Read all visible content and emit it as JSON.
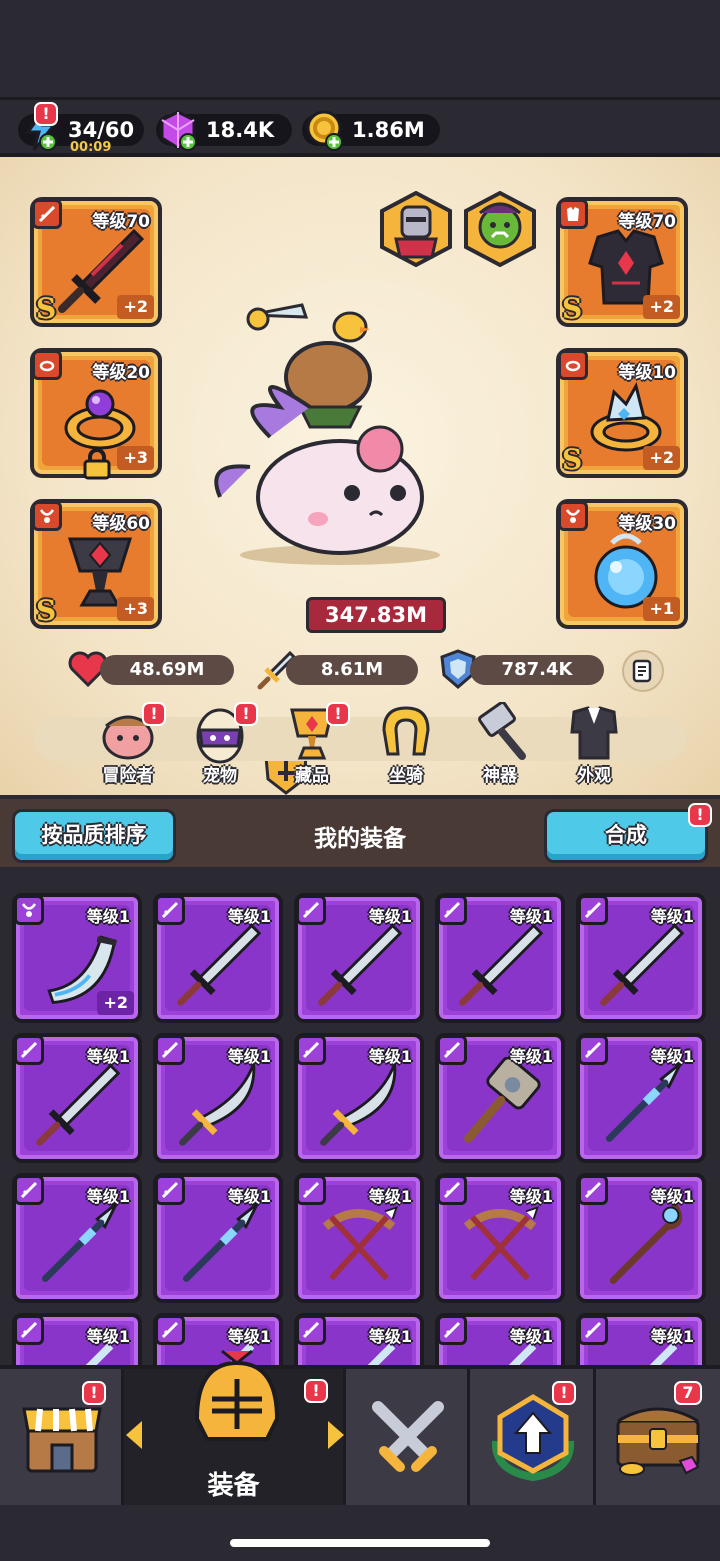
{
  "resources": {
    "energy": {
      "value": "34/60",
      "timer": "00:09",
      "icon": "lightning-icon"
    },
    "gems": {
      "value": "18.4K",
      "icon": "gem-icon"
    },
    "coins": {
      "value": "1.86M",
      "icon": "coin-icon"
    }
  },
  "left_equipment": [
    {
      "slot": "weapon",
      "level": "等级70",
      "grade": "S",
      "plus": "+2",
      "icon": "dark-sword-icon"
    },
    {
      "slot": "ring",
      "level": "等级20",
      "grade": "",
      "plus": "+3",
      "icon": "ring-icon",
      "locked": true
    },
    {
      "slot": "necklace",
      "level": "等级60",
      "grade": "S",
      "plus": "+3",
      "icon": "chalice-amulet-icon"
    }
  ],
  "right_equipment": [
    {
      "slot": "armor",
      "level": "等级70",
      "grade": "S",
      "plus": "+2",
      "icon": "dark-armor-icon"
    },
    {
      "slot": "ring",
      "level": "等级10",
      "grade": "S",
      "plus": "+2",
      "icon": "crystal-ring-icon"
    },
    {
      "slot": "necklace",
      "level": "等级30",
      "grade": "",
      "plus": "+1",
      "icon": "blue-orb-icon"
    }
  ],
  "portraits": [
    "knight-portrait-icon",
    "orc-portrait-icon"
  ],
  "power": "347.83M",
  "stats": {
    "hp": "48.69M",
    "attack": "8.61M",
    "defense": "787.4K"
  },
  "features": [
    {
      "label": "冒险者",
      "icon": "adventurer-icon",
      "alert": true
    },
    {
      "label": "宠物",
      "icon": "pet-egg-icon",
      "alert": true
    },
    {
      "label": "藏品",
      "icon": "collection-trophy-icon",
      "alert": true
    },
    {
      "label": "坐骑",
      "icon": "mount-horseshoe-icon",
      "alert": false
    },
    {
      "label": "神器",
      "icon": "artifact-hammer-icon",
      "alert": false
    },
    {
      "label": "外观",
      "icon": "outfit-icon",
      "alert": false
    }
  ],
  "inventory": {
    "sort_label": "按品质排序",
    "title": "我的装备",
    "merge_label": "合成",
    "merge_alert": "!",
    "item_level": "等级1",
    "rows": [
      [
        {
          "icon": "horn-icon",
          "type": "necklace",
          "plus": "+2"
        },
        {
          "icon": "iron-sword-icon",
          "type": "weapon"
        },
        {
          "icon": "iron-sword-icon",
          "type": "weapon"
        },
        {
          "icon": "iron-sword-icon",
          "type": "weapon"
        },
        {
          "icon": "iron-sword-icon",
          "type": "weapon"
        }
      ],
      [
        {
          "icon": "iron-sword-icon",
          "type": "weapon"
        },
        {
          "icon": "scimitar-icon",
          "type": "weapon"
        },
        {
          "icon": "scimitar-icon",
          "type": "weapon"
        },
        {
          "icon": "stone-hammer-icon",
          "type": "weapon"
        },
        {
          "icon": "spear-icon",
          "type": "weapon"
        }
      ],
      [
        {
          "icon": "spear-icon",
          "type": "weapon"
        },
        {
          "icon": "spear-icon",
          "type": "weapon"
        },
        {
          "icon": "crossbow-icon",
          "type": "weapon"
        },
        {
          "icon": "crossbow-icon",
          "type": "weapon"
        },
        {
          "icon": "staff-icon",
          "type": "weapon"
        }
      ],
      [
        {
          "icon": "weapon-icon",
          "type": "weapon"
        },
        {
          "icon": "weapon-icon",
          "type": "weapon"
        },
        {
          "icon": "weapon-icon",
          "type": "weapon"
        },
        {
          "icon": "weapon-icon",
          "type": "weapon"
        },
        {
          "icon": "weapon-icon",
          "type": "weapon"
        }
      ]
    ]
  },
  "bottom_nav": [
    {
      "id": "shop",
      "label": "",
      "icon": "shop-icon",
      "badge": "!"
    },
    {
      "id": "equipment",
      "label": "装备",
      "icon": "helmet-icon",
      "badge": "!",
      "active": true
    },
    {
      "id": "battle",
      "label": "",
      "icon": "crossed-swords-icon",
      "badge": ""
    },
    {
      "id": "upgrade",
      "label": "",
      "icon": "upgrade-emblem-icon",
      "badge": "!"
    },
    {
      "id": "chest",
      "label": "",
      "icon": "treasure-chest-icon",
      "badge": "7"
    }
  ],
  "colors": {
    "background": "#2b2a33",
    "panel": "#f3e4c7",
    "orange_slot": "#f0a43c",
    "purple_slot": "#9c42d8",
    "accent_cyan": "#4fc9e8",
    "badge_red": "#e8364b",
    "power_red": "#a8293b"
  }
}
